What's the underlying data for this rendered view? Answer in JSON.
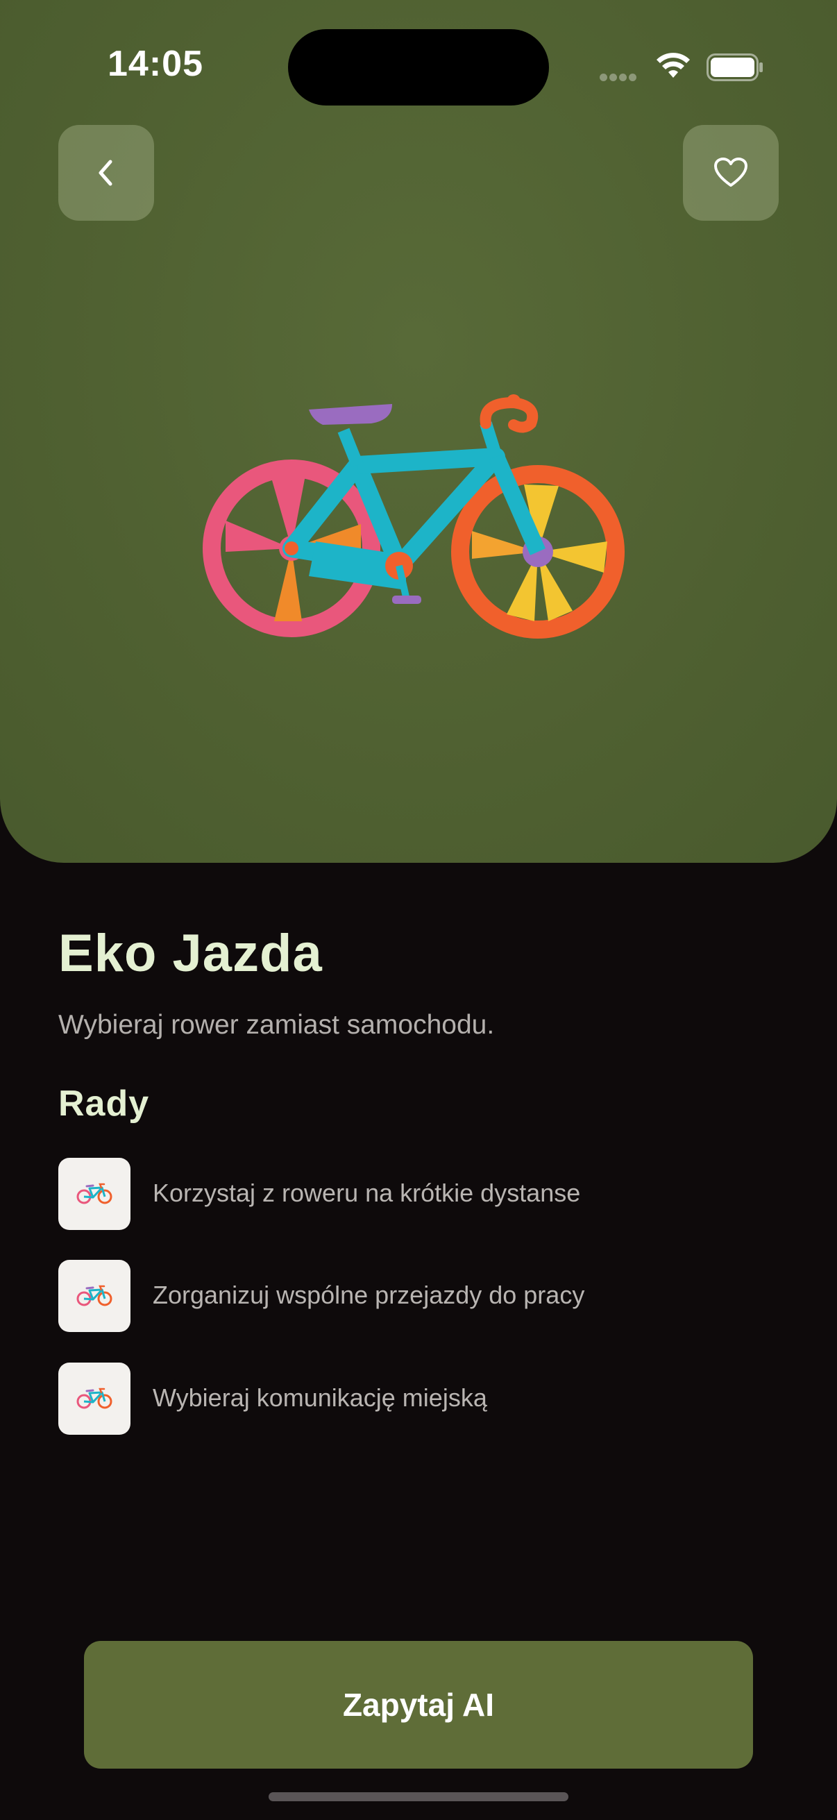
{
  "status_bar": {
    "time": "14:05"
  },
  "hero": {
    "image_alt": "bicycle-illustration",
    "back_icon": "chevron-left-icon",
    "favorite_icon": "heart-icon",
    "background_color": "#4f6031"
  },
  "content": {
    "title": "Eko Jazda",
    "subtitle": "Wybieraj rower zamiast samochodu.",
    "tips_heading": "Rady",
    "tips": [
      {
        "icon": "bicycle-icon",
        "text": "Korzystaj z roweru na krótkie dystanse"
      },
      {
        "icon": "bicycle-icon",
        "text": "Zorganizuj wspólne przejazdy do pracy"
      },
      {
        "icon": "bicycle-icon",
        "text": "Wybieraj komunikację miejską"
      }
    ]
  },
  "actions": {
    "ask_ai_label": "Zapytaj AI",
    "accent_color": "#5f6d38"
  }
}
